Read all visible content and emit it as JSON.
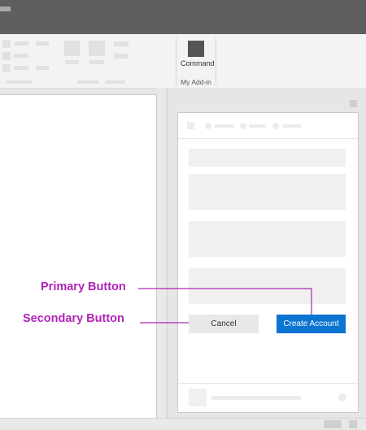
{
  "ribbon": {
    "command_label": "Command",
    "group_label": "My Add-in",
    "command_icon": "command-square-icon"
  },
  "form": {
    "cancel_label": "Cancel",
    "create_label": "Create Account"
  },
  "annotations": {
    "primary_label": "Primary Button",
    "secondary_label": "Secondary Button",
    "color": "#b123b8"
  },
  "colors": {
    "primary": "#0b74d1",
    "secondary": "#e8e8e8",
    "titlebar": "#5f5f5f"
  }
}
